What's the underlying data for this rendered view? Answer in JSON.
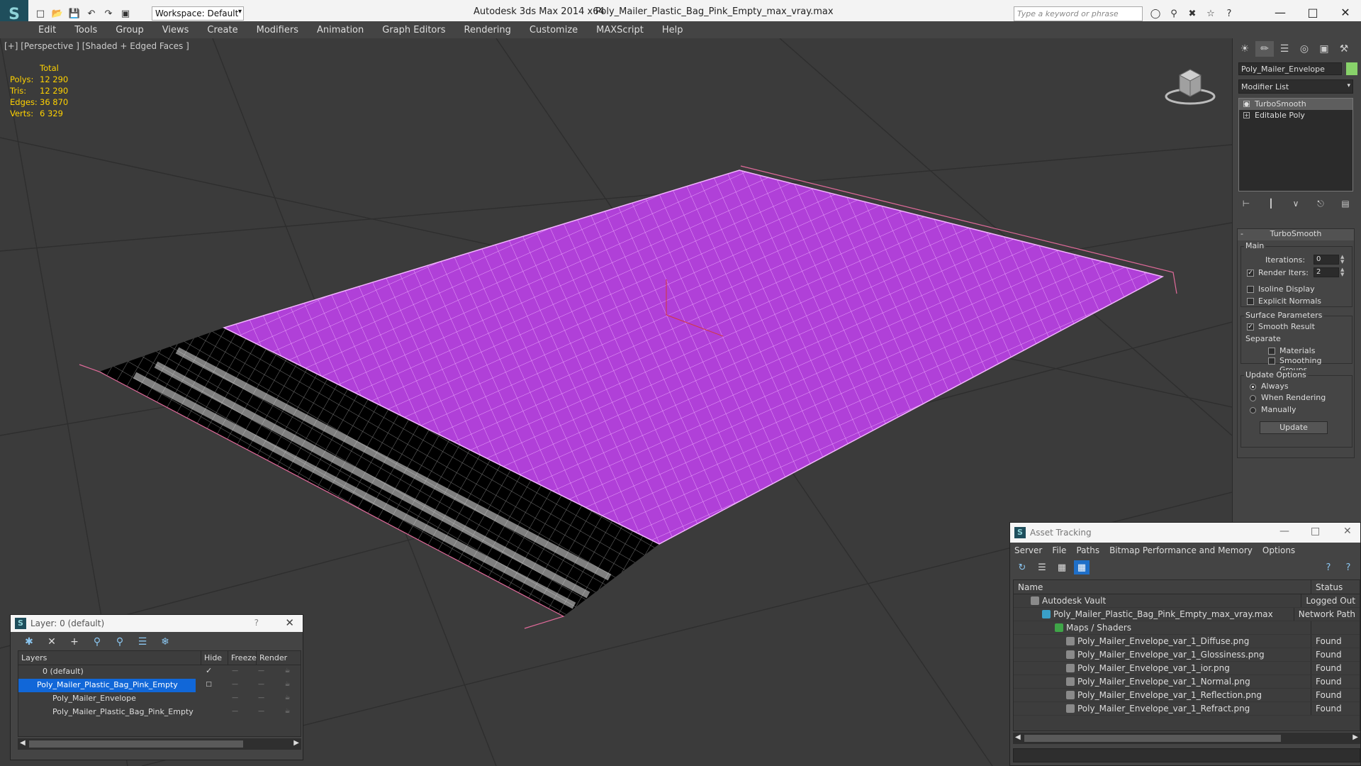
{
  "titlebar": {
    "app_title": "Autodesk 3ds Max  2014 x64",
    "file_title": "Poly_Mailer_Plastic_Bag_Pink_Empty_max_vray.max",
    "workspace": "Workspace: Default",
    "search_placeholder": "Type a keyword or phrase"
  },
  "menubar": {
    "items": [
      "Edit",
      "Tools",
      "Group",
      "Views",
      "Create",
      "Modifiers",
      "Animation",
      "Graph Editors",
      "Rendering",
      "Customize",
      "MAXScript",
      "Help"
    ]
  },
  "viewport": {
    "label": "[+] [Perspective ] [Shaded + Edged Faces ]",
    "stats": {
      "header": "Total",
      "rows": [
        {
          "key": "Polys:",
          "value": "12 290"
        },
        {
          "key": "Tris:",
          "value": "12 290"
        },
        {
          "key": "Edges:",
          "value": "36 870"
        },
        {
          "key": "Verts:",
          "value": "6 329"
        }
      ]
    },
    "colors": {
      "mesh": "#b040d8",
      "wire": "#f0b0ff",
      "background": "#3b3b3b"
    }
  },
  "command_panel": {
    "object_name": "Poly_Mailer_Envelope",
    "object_color": "#88d26a",
    "modifier_list": "Modifier List",
    "stack": [
      "TurboSmooth",
      "Editable Poly"
    ],
    "rollout": {
      "title": "TurboSmooth",
      "main_label": "Main",
      "iterations_label": "Iterations:",
      "iterations_value": "0",
      "render_iters_label": "Render Iters:",
      "render_iters_value": "2",
      "isoline_label": "Isoline Display",
      "explicit_label": "Explicit Normals",
      "surface_label": "Surface Parameters",
      "smooth_label": "Smooth Result",
      "separate_label": "Separate",
      "materials_label": "Materials",
      "smoothing_label": "Smoothing Groups",
      "update_options_label": "Update Options",
      "always_label": "Always",
      "when_rendering_label": "When Rendering",
      "manually_label": "Manually",
      "update_button": "Update"
    }
  },
  "layer_window": {
    "title": "Layer: 0 (default)",
    "help": "?",
    "columns": [
      "Layers",
      "Hide",
      "Freeze",
      "Render"
    ],
    "rows": [
      {
        "name": "0 (default)",
        "selected": false
      },
      {
        "name": "Poly_Mailer_Plastic_Bag_Pink_Empty",
        "selected": true
      },
      {
        "name": "Poly_Mailer_Envelope",
        "selected": false
      },
      {
        "name": "Poly_Mailer_Plastic_Bag_Pink_Empty",
        "selected": false
      }
    ]
  },
  "asset_window": {
    "title": "Asset Tracking",
    "menu": [
      "Server",
      "File",
      "Paths",
      "Bitmap Performance and Memory",
      "Options"
    ],
    "columns": [
      "Name",
      "Status"
    ],
    "rows": [
      {
        "name": "Autodesk Vault",
        "status": "Logged Out",
        "indent": 0
      },
      {
        "name": "Poly_Mailer_Plastic_Bag_Pink_Empty_max_vray.max",
        "status": "Network Path",
        "indent": 1
      },
      {
        "name": "Maps / Shaders",
        "status": "",
        "indent": 2
      },
      {
        "name": "Poly_Mailer_Envelope_var_1_Diffuse.png",
        "status": "Found",
        "indent": 3
      },
      {
        "name": "Poly_Mailer_Envelope_var_1_Glossiness.png",
        "status": "Found",
        "indent": 3
      },
      {
        "name": "Poly_Mailer_Envelope_var_1_ior.png",
        "status": "Found",
        "indent": 3
      },
      {
        "name": "Poly_Mailer_Envelope_var_1_Normal.png",
        "status": "Found",
        "indent": 3
      },
      {
        "name": "Poly_Mailer_Envelope_var_1_Reflection.png",
        "status": "Found",
        "indent": 3
      },
      {
        "name": "Poly_Mailer_Envelope_var_1_Refract.png",
        "status": "Found",
        "indent": 3
      }
    ]
  }
}
